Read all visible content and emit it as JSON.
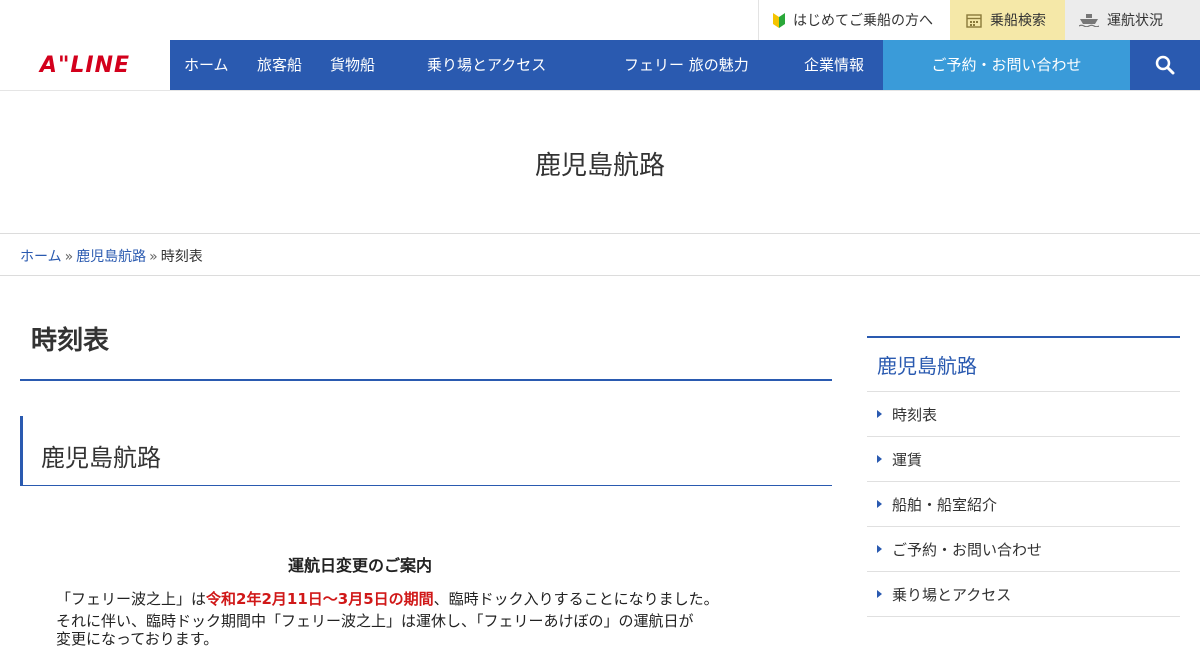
{
  "utility": {
    "beginner_label": "はじめてご乗船の方へ",
    "search_label": "乗船検索",
    "status_label": "運航状況"
  },
  "brand": {
    "logo_text": "A\"LINE"
  },
  "nav": {
    "items": [
      "ホーム",
      "旅客船",
      "貨物船",
      "乗り場とアクセス",
      "フェリー 旅の魅力",
      "企業情報"
    ],
    "contact_label": "ご予約・お問い合わせ"
  },
  "hero": {
    "title": "鹿児島航路"
  },
  "breadcrumb": {
    "items": [
      "ホーム",
      "鹿児島航路",
      "時刻表"
    ],
    "separator": "»"
  },
  "main": {
    "page_title": "時刻表",
    "section_title": "鹿児島航路",
    "notice": {
      "title": "運航日変更のご案内",
      "line1_a": "「フェリー波之上」は",
      "line1_red": "令和2年2月11日〜3月5日の期間",
      "line1_b": "、臨時ドック入りすることになりました。",
      "line2": "それに伴い、臨時ドック期間中「フェリー波之上」は運休し、「フェリーあけぼの」の運航日が",
      "line3": "変更になっております。"
    }
  },
  "sidebar": {
    "heading": "鹿児島航路",
    "items": [
      "時刻表",
      "運賃",
      "船舶・船室紹介",
      "ご予約・お問い合わせ",
      "乗り場とアクセス"
    ]
  },
  "colors": {
    "nav_blue": "#2a5ab0",
    "contact_blue": "#3a9bd9",
    "logo_red": "#d3001c",
    "search_yellow": "#f5e8a8",
    "status_gray": "#ececec"
  }
}
